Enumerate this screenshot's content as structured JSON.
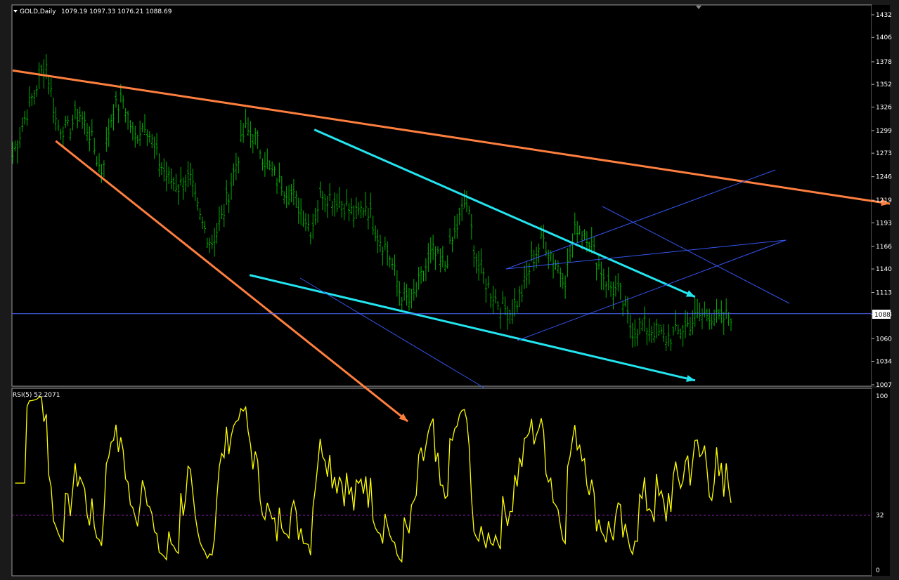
{
  "header": {
    "symbol": "GOLD,Daily",
    "ohlc": "1079.19 1097.33 1076.21 1088.69"
  },
  "rsi_header": "RSI(5) 52.2071",
  "current_price_label": "1088",
  "colors": {
    "background": "#000000",
    "price_bars": "#00b000",
    "rsi_line": "#ffff00",
    "trend_orange": "#ff7f3f",
    "trend_cyan": "#22e5f0",
    "channel_blue": "#3355ee",
    "current_price_line": "#4a6cff",
    "rsi_level": "#a020c0"
  },
  "chart_data": [
    {
      "type": "bar",
      "title": "GOLD,Daily",
      "y_ticks": [
        "1432",
        "1406",
        "1378",
        "1352",
        "1326",
        "1299",
        "1273",
        "1246",
        "1219",
        "1193",
        "1166",
        "1140",
        "1113",
        "1088",
        "1060",
        "1034",
        "1007"
      ],
      "ylim": [
        1007,
        1432
      ],
      "current_price": 1088.69,
      "close_path_approx": [
        1270,
        1310,
        1345,
        1378,
        1305,
        1300,
        1320,
        1295,
        1250,
        1320,
        1335,
        1290,
        1310,
        1270,
        1245,
        1235,
        1245,
        1195,
        1170,
        1200,
        1250,
        1300,
        1290,
        1260,
        1240,
        1230,
        1210,
        1185,
        1230,
        1220,
        1215,
        1200,
        1215,
        1180,
        1160,
        1115,
        1100,
        1130,
        1160,
        1140,
        1180,
        1220,
        1150,
        1120,
        1100,
        1090,
        1110,
        1150,
        1175,
        1150,
        1130,
        1190,
        1180,
        1145,
        1120,
        1110,
        1070,
        1075,
        1070,
        1060,
        1065,
        1075,
        1085,
        1090,
        1080,
        1088
      ],
      "trendlines": [
        {
          "color": "orange",
          "from": [
            0,
            1368
          ],
          "to": [
            "end",
            1215
          ]
        },
        {
          "color": "orange",
          "from": [
            0.06,
            1287
          ],
          "to": [
            0.55,
            965
          ]
        },
        {
          "color": "cyan",
          "from": [
            0.42,
            1300
          ],
          "to": [
            0.95,
            1108
          ]
        },
        {
          "color": "cyan",
          "from": [
            0.33,
            1133
          ],
          "to": [
            0.95,
            1012
          ]
        }
      ]
    },
    {
      "type": "line",
      "title": "RSI(5) 52.2071",
      "y_ticks": [
        "100",
        "32",
        "0"
      ],
      "ylim": [
        0,
        100
      ],
      "level": 32,
      "last_value": 52.2071
    }
  ]
}
